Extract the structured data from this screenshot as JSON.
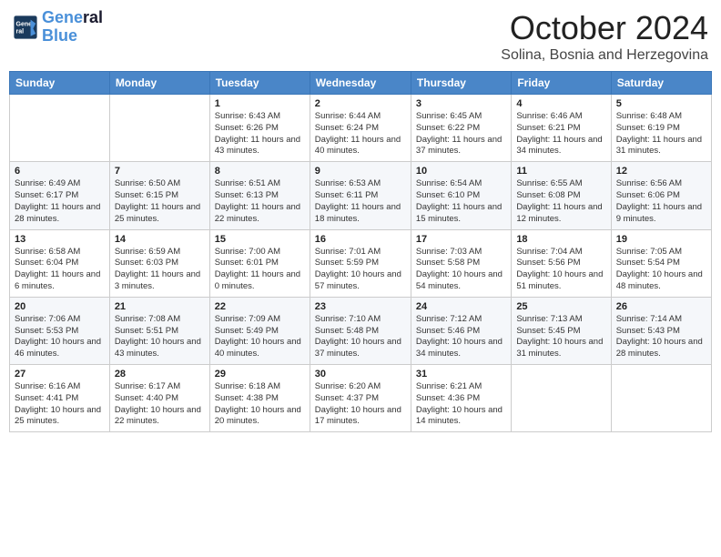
{
  "header": {
    "logo_line1": "General",
    "logo_line2": "Blue",
    "month": "October 2024",
    "location": "Solina, Bosnia and Herzegovina"
  },
  "weekdays": [
    "Sunday",
    "Monday",
    "Tuesday",
    "Wednesday",
    "Thursday",
    "Friday",
    "Saturday"
  ],
  "weeks": [
    [
      {
        "day": "",
        "text": ""
      },
      {
        "day": "",
        "text": ""
      },
      {
        "day": "1",
        "text": "Sunrise: 6:43 AM\nSunset: 6:26 PM\nDaylight: 11 hours and 43 minutes."
      },
      {
        "day": "2",
        "text": "Sunrise: 6:44 AM\nSunset: 6:24 PM\nDaylight: 11 hours and 40 minutes."
      },
      {
        "day": "3",
        "text": "Sunrise: 6:45 AM\nSunset: 6:22 PM\nDaylight: 11 hours and 37 minutes."
      },
      {
        "day": "4",
        "text": "Sunrise: 6:46 AM\nSunset: 6:21 PM\nDaylight: 11 hours and 34 minutes."
      },
      {
        "day": "5",
        "text": "Sunrise: 6:48 AM\nSunset: 6:19 PM\nDaylight: 11 hours and 31 minutes."
      }
    ],
    [
      {
        "day": "6",
        "text": "Sunrise: 6:49 AM\nSunset: 6:17 PM\nDaylight: 11 hours and 28 minutes."
      },
      {
        "day": "7",
        "text": "Sunrise: 6:50 AM\nSunset: 6:15 PM\nDaylight: 11 hours and 25 minutes."
      },
      {
        "day": "8",
        "text": "Sunrise: 6:51 AM\nSunset: 6:13 PM\nDaylight: 11 hours and 22 minutes."
      },
      {
        "day": "9",
        "text": "Sunrise: 6:53 AM\nSunset: 6:11 PM\nDaylight: 11 hours and 18 minutes."
      },
      {
        "day": "10",
        "text": "Sunrise: 6:54 AM\nSunset: 6:10 PM\nDaylight: 11 hours and 15 minutes."
      },
      {
        "day": "11",
        "text": "Sunrise: 6:55 AM\nSunset: 6:08 PM\nDaylight: 11 hours and 12 minutes."
      },
      {
        "day": "12",
        "text": "Sunrise: 6:56 AM\nSunset: 6:06 PM\nDaylight: 11 hours and 9 minutes."
      }
    ],
    [
      {
        "day": "13",
        "text": "Sunrise: 6:58 AM\nSunset: 6:04 PM\nDaylight: 11 hours and 6 minutes."
      },
      {
        "day": "14",
        "text": "Sunrise: 6:59 AM\nSunset: 6:03 PM\nDaylight: 11 hours and 3 minutes."
      },
      {
        "day": "15",
        "text": "Sunrise: 7:00 AM\nSunset: 6:01 PM\nDaylight: 11 hours and 0 minutes."
      },
      {
        "day": "16",
        "text": "Sunrise: 7:01 AM\nSunset: 5:59 PM\nDaylight: 10 hours and 57 minutes."
      },
      {
        "day": "17",
        "text": "Sunrise: 7:03 AM\nSunset: 5:58 PM\nDaylight: 10 hours and 54 minutes."
      },
      {
        "day": "18",
        "text": "Sunrise: 7:04 AM\nSunset: 5:56 PM\nDaylight: 10 hours and 51 minutes."
      },
      {
        "day": "19",
        "text": "Sunrise: 7:05 AM\nSunset: 5:54 PM\nDaylight: 10 hours and 48 minutes."
      }
    ],
    [
      {
        "day": "20",
        "text": "Sunrise: 7:06 AM\nSunset: 5:53 PM\nDaylight: 10 hours and 46 minutes."
      },
      {
        "day": "21",
        "text": "Sunrise: 7:08 AM\nSunset: 5:51 PM\nDaylight: 10 hours and 43 minutes."
      },
      {
        "day": "22",
        "text": "Sunrise: 7:09 AM\nSunset: 5:49 PM\nDaylight: 10 hours and 40 minutes."
      },
      {
        "day": "23",
        "text": "Sunrise: 7:10 AM\nSunset: 5:48 PM\nDaylight: 10 hours and 37 minutes."
      },
      {
        "day": "24",
        "text": "Sunrise: 7:12 AM\nSunset: 5:46 PM\nDaylight: 10 hours and 34 minutes."
      },
      {
        "day": "25",
        "text": "Sunrise: 7:13 AM\nSunset: 5:45 PM\nDaylight: 10 hours and 31 minutes."
      },
      {
        "day": "26",
        "text": "Sunrise: 7:14 AM\nSunset: 5:43 PM\nDaylight: 10 hours and 28 minutes."
      }
    ],
    [
      {
        "day": "27",
        "text": "Sunrise: 6:16 AM\nSunset: 4:41 PM\nDaylight: 10 hours and 25 minutes."
      },
      {
        "day": "28",
        "text": "Sunrise: 6:17 AM\nSunset: 4:40 PM\nDaylight: 10 hours and 22 minutes."
      },
      {
        "day": "29",
        "text": "Sunrise: 6:18 AM\nSunset: 4:38 PM\nDaylight: 10 hours and 20 minutes."
      },
      {
        "day": "30",
        "text": "Sunrise: 6:20 AM\nSunset: 4:37 PM\nDaylight: 10 hours and 17 minutes."
      },
      {
        "day": "31",
        "text": "Sunrise: 6:21 AM\nSunset: 4:36 PM\nDaylight: 10 hours and 14 minutes."
      },
      {
        "day": "",
        "text": ""
      },
      {
        "day": "",
        "text": ""
      }
    ]
  ]
}
